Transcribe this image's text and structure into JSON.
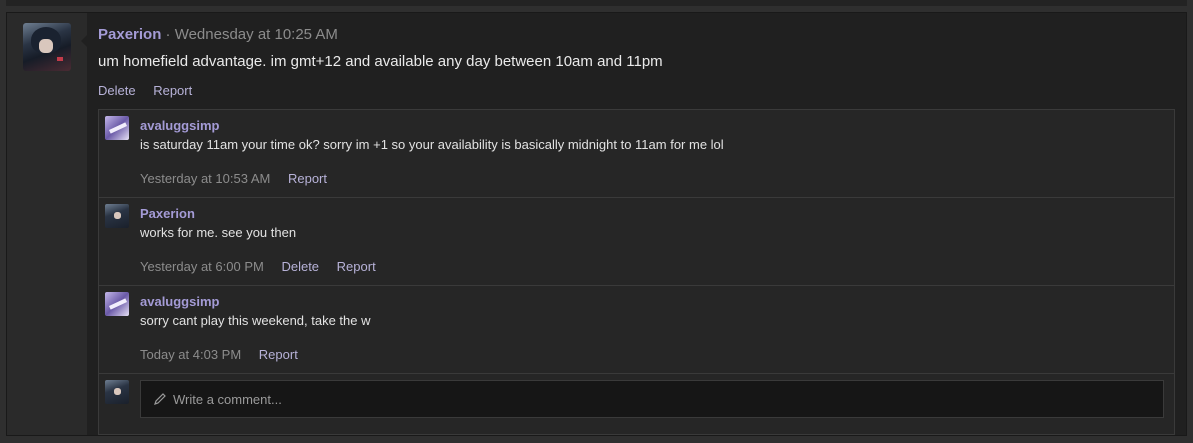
{
  "post": {
    "author": "Paxerion",
    "time": " · Wednesday at 10:25 AM",
    "text": "um homefield advantage. im gmt+12 and available any day between 10am and 11pm",
    "actions": {
      "delete": "Delete",
      "report": "Report"
    }
  },
  "comments": [
    {
      "author": "avaluggsimp",
      "text": "is saturday 11am your time ok? sorry im +1 so your availability is basically midnight to 11am for me lol",
      "time": "Yesterday at 10:53 AM",
      "report": "Report"
    },
    {
      "author": "Paxerion",
      "text": "works for me. see you then",
      "time": "Yesterday at 6:00 PM",
      "delete": "Delete",
      "report": "Report"
    },
    {
      "author": "avaluggsimp",
      "text": "sorry cant play this weekend, take the w",
      "time": "Today at 4:03 PM",
      "report": "Report"
    }
  ],
  "reply": {
    "placeholder": "Write a comment..."
  },
  "colors": {
    "accent": "#a49bd6",
    "link": "#b7b2d8",
    "background": "#202020"
  },
  "icons": [
    "user-avatar",
    "pencil-icon"
  ]
}
